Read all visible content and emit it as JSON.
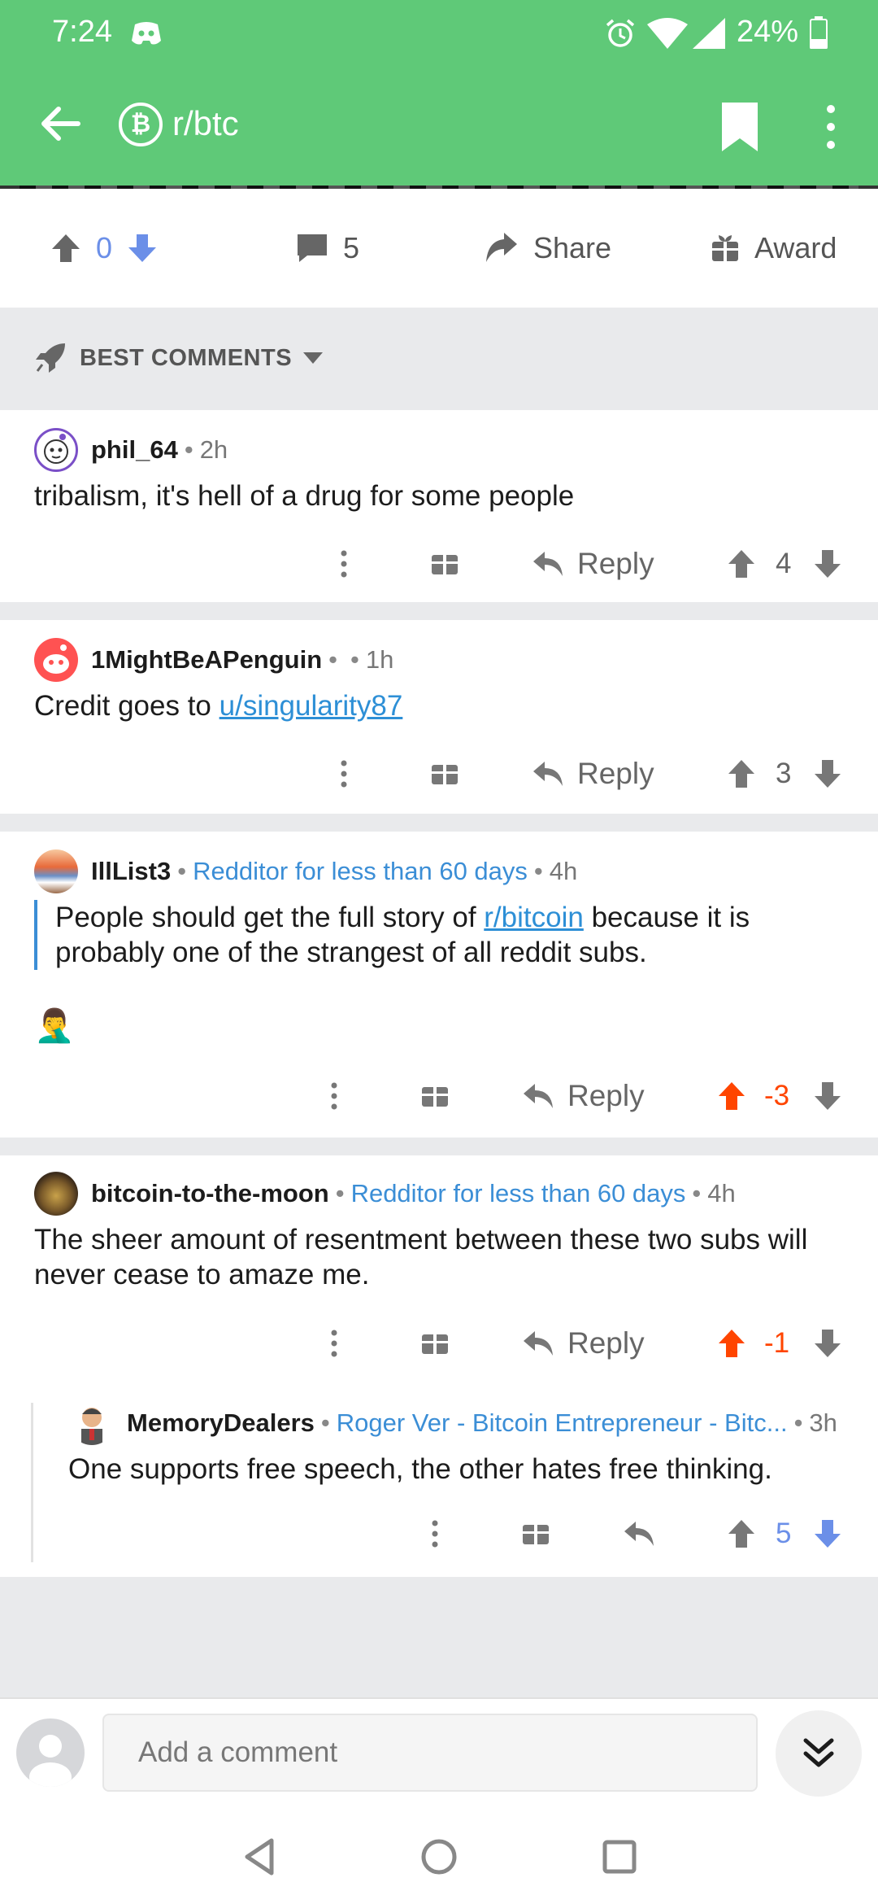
{
  "status_bar": {
    "time": "7:24",
    "battery": "24%",
    "icons": [
      "discord-icon",
      "alarm-icon",
      "wifi-icon",
      "signal-icon",
      "battery-icon"
    ]
  },
  "app_bar": {
    "subreddit": "r/btc",
    "subreddit_icon_glyph": "₿",
    "icons": [
      "back-arrow-icon",
      "bookmark-icon",
      "more-vert-icon"
    ]
  },
  "post_actions": {
    "vote_count": "0",
    "comment_count": "5",
    "share_label": "Share",
    "award_label": "Award"
  },
  "sort": {
    "label": "BEST COMMENTS"
  },
  "comments": [
    {
      "user": "phil_64",
      "time": "2h",
      "text": "tribalism, it's hell of a drug for some people",
      "reply_label": "Reply",
      "score": "4"
    },
    {
      "user": "1MightBeAPenguin",
      "time": "1h",
      "text_prefix": "Credit goes to ",
      "link": "u/singularity87",
      "reply_label": "Reply",
      "score": "3"
    },
    {
      "user": "IllList3",
      "flair": "Redditor for less than 60 days",
      "time": "4h",
      "quote_prefix": "People should get the full story of ",
      "quote_link": "r/bitcoin",
      "quote_suffix": " because it is probably one of the strangest of all reddit subs.",
      "emoji": "🤦‍♂️",
      "reply_label": "Reply",
      "score": "-3"
    },
    {
      "user": "bitcoin-to-the-moon",
      "flair": "Redditor for less than 60 days",
      "time": "4h",
      "text": "The sheer amount of resentment between these two subs will never cease to amaze me.",
      "reply_label": "Reply",
      "score": "-1"
    },
    {
      "user": "MemoryDealers",
      "flair": "Roger Ver - Bitcoin Entrepreneur - Bitc...",
      "time": "3h",
      "text": "One supports free speech, the other hates free thinking.",
      "score": "5"
    }
  ],
  "composer": {
    "placeholder": "Add a comment"
  },
  "colors": {
    "header_green": "#5fc978",
    "upvote_orange": "#ff4500",
    "downvote_blue": "#6b8fe8",
    "flair_blue": "#3b8ed6"
  }
}
